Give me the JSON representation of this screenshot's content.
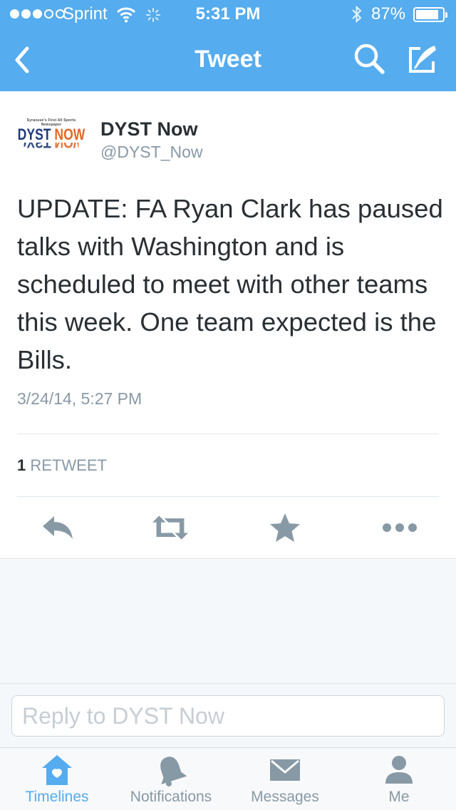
{
  "status_bar": {
    "carrier": "Sprint",
    "signal_bars_filled": 3,
    "signal_bars_total": 5,
    "time": "5:31 PM",
    "battery": "87%",
    "battery_level": 0.87
  },
  "nav": {
    "title": "Tweet",
    "back_icon": "chevron-left-icon",
    "search_icon": "search-icon",
    "compose_icon": "compose-icon"
  },
  "tweet": {
    "avatar_logo": {
      "tagline": "Syracuse's First All Sports Newspaper",
      "word1": "DYST",
      "word2": "NOW"
    },
    "author_name": "DYST Now",
    "author_handle": "@DYST_Now",
    "text": "UPDATE: FA Ryan Clark has paused talks with Washington and is scheduled to meet with other teams this week. One team expected is the Bills.",
    "timestamp": "3/24/14, 5:27 PM",
    "retweet_count": "1",
    "retweet_label": "RETWEET",
    "actions": [
      "reply-icon",
      "retweet-icon",
      "favorite-icon",
      "more-icon"
    ]
  },
  "reply": {
    "placeholder": "Reply to DYST Now"
  },
  "tabs": [
    {
      "label": "Timelines",
      "icon": "home-icon",
      "active": true
    },
    {
      "label": "Notifications",
      "icon": "bell-icon",
      "active": false
    },
    {
      "label": "Messages",
      "icon": "envelope-icon",
      "active": false
    },
    {
      "label": "Me",
      "icon": "person-icon",
      "active": false
    }
  ],
  "colors": {
    "brand": "#55acee",
    "text": "#292f33",
    "muted": "#8899a6",
    "action_icon": "#8899a6"
  }
}
